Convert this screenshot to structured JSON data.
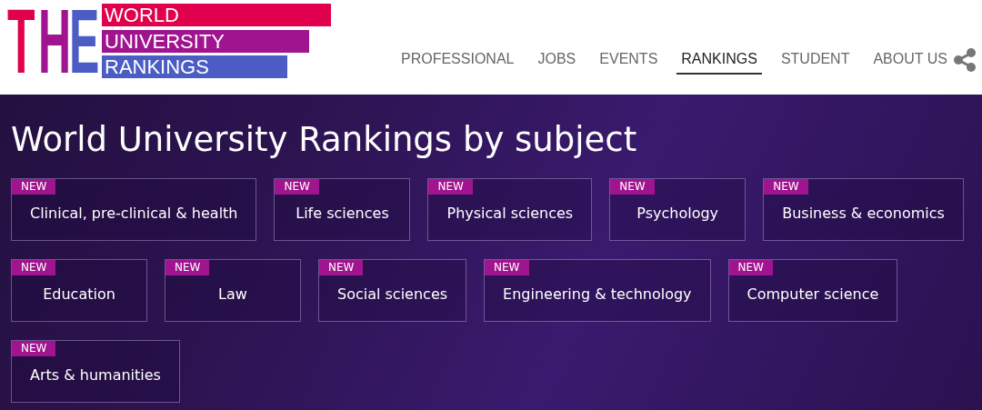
{
  "logo": {
    "letters": [
      {
        "text": "T",
        "color": "#e0004d"
      },
      {
        "text": "H",
        "color": "#a0158f"
      },
      {
        "text": "E",
        "color": "#4b5cc4"
      }
    ],
    "lines": [
      {
        "text": "WORLD",
        "color": "#e0004d"
      },
      {
        "text": "UNIVERSITY",
        "color": "#a0158f"
      },
      {
        "text": "RANKINGS",
        "color": "#4b5cc4"
      }
    ]
  },
  "nav": [
    {
      "label": "PROFESSIONAL",
      "selected": false
    },
    {
      "label": "JOBS",
      "selected": false
    },
    {
      "label": "EVENTS",
      "selected": false
    },
    {
      "label": "RANKINGS",
      "selected": true
    },
    {
      "label": "STUDENT",
      "selected": false
    },
    {
      "label": "ABOUT US",
      "selected": false
    }
  ],
  "title": "World University Rankings by subject",
  "subjects": [
    {
      "badge": "NEW",
      "label": "Clinical, pre-clinical & health"
    },
    {
      "badge": "NEW",
      "label": "Life sciences"
    },
    {
      "badge": "NEW",
      "label": "Physical sciences"
    },
    {
      "badge": "NEW",
      "label": "Psychology"
    },
    {
      "badge": "NEW",
      "label": "Business & economics"
    },
    {
      "badge": "NEW",
      "label": "Education"
    },
    {
      "badge": "NEW",
      "label": "Law"
    },
    {
      "badge": "NEW",
      "label": "Social sciences"
    },
    {
      "badge": "NEW",
      "label": "Engineering & technology"
    },
    {
      "badge": "NEW",
      "label": "Computer science"
    },
    {
      "badge": "NEW",
      "label": "Arts & humanities"
    }
  ]
}
